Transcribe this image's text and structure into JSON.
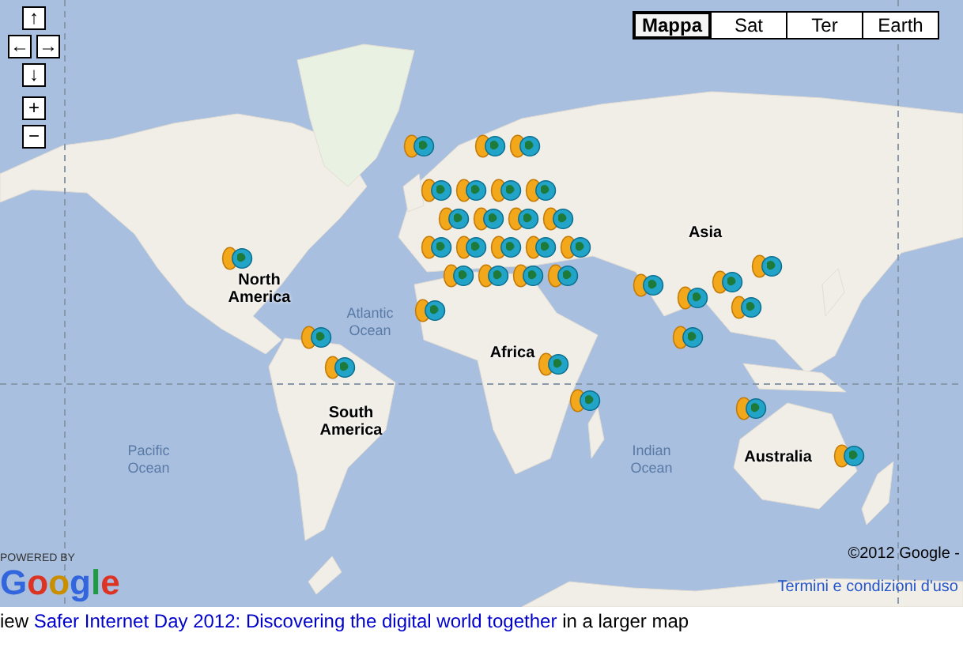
{
  "nav_controls": [
    {
      "kind": "up",
      "label": "↑"
    },
    {
      "kind": "left",
      "label": "←"
    },
    {
      "kind": "right",
      "label": "→"
    },
    {
      "kind": "down",
      "label": "↓"
    },
    {
      "kind": "zoom_in",
      "label": "+"
    },
    {
      "kind": "zoom_out",
      "label": "−"
    }
  ],
  "map_types": [
    {
      "label": "Mappa",
      "selected": true
    },
    {
      "label": "Sat",
      "selected": false
    },
    {
      "label": "Ter",
      "selected": false
    },
    {
      "label": "Earth",
      "selected": false
    }
  ],
  "map_labels": [
    {
      "kind": "land",
      "text": "Asia"
    },
    {
      "kind": "land",
      "text": "North America"
    },
    {
      "kind": "ocean",
      "text": "Atlantic Ocean"
    },
    {
      "kind": "land",
      "text": "Africa"
    },
    {
      "kind": "land",
      "text": "South America"
    },
    {
      "kind": "ocean",
      "text": "Pacific Ocean"
    },
    {
      "kind": "ocean",
      "text": "Indian Ocean"
    },
    {
      "kind": "land",
      "text": "Australia"
    }
  ],
  "powered_by": "POWERED BY",
  "logo": "Google",
  "copyright": "©2012 Google -",
  "terms_link": "Termini e condizioni d'uso",
  "caption": {
    "before": "iew",
    "link": "Safer Internet Day 2012: Discovering the digital world together",
    "after": "in a larger map"
  }
}
